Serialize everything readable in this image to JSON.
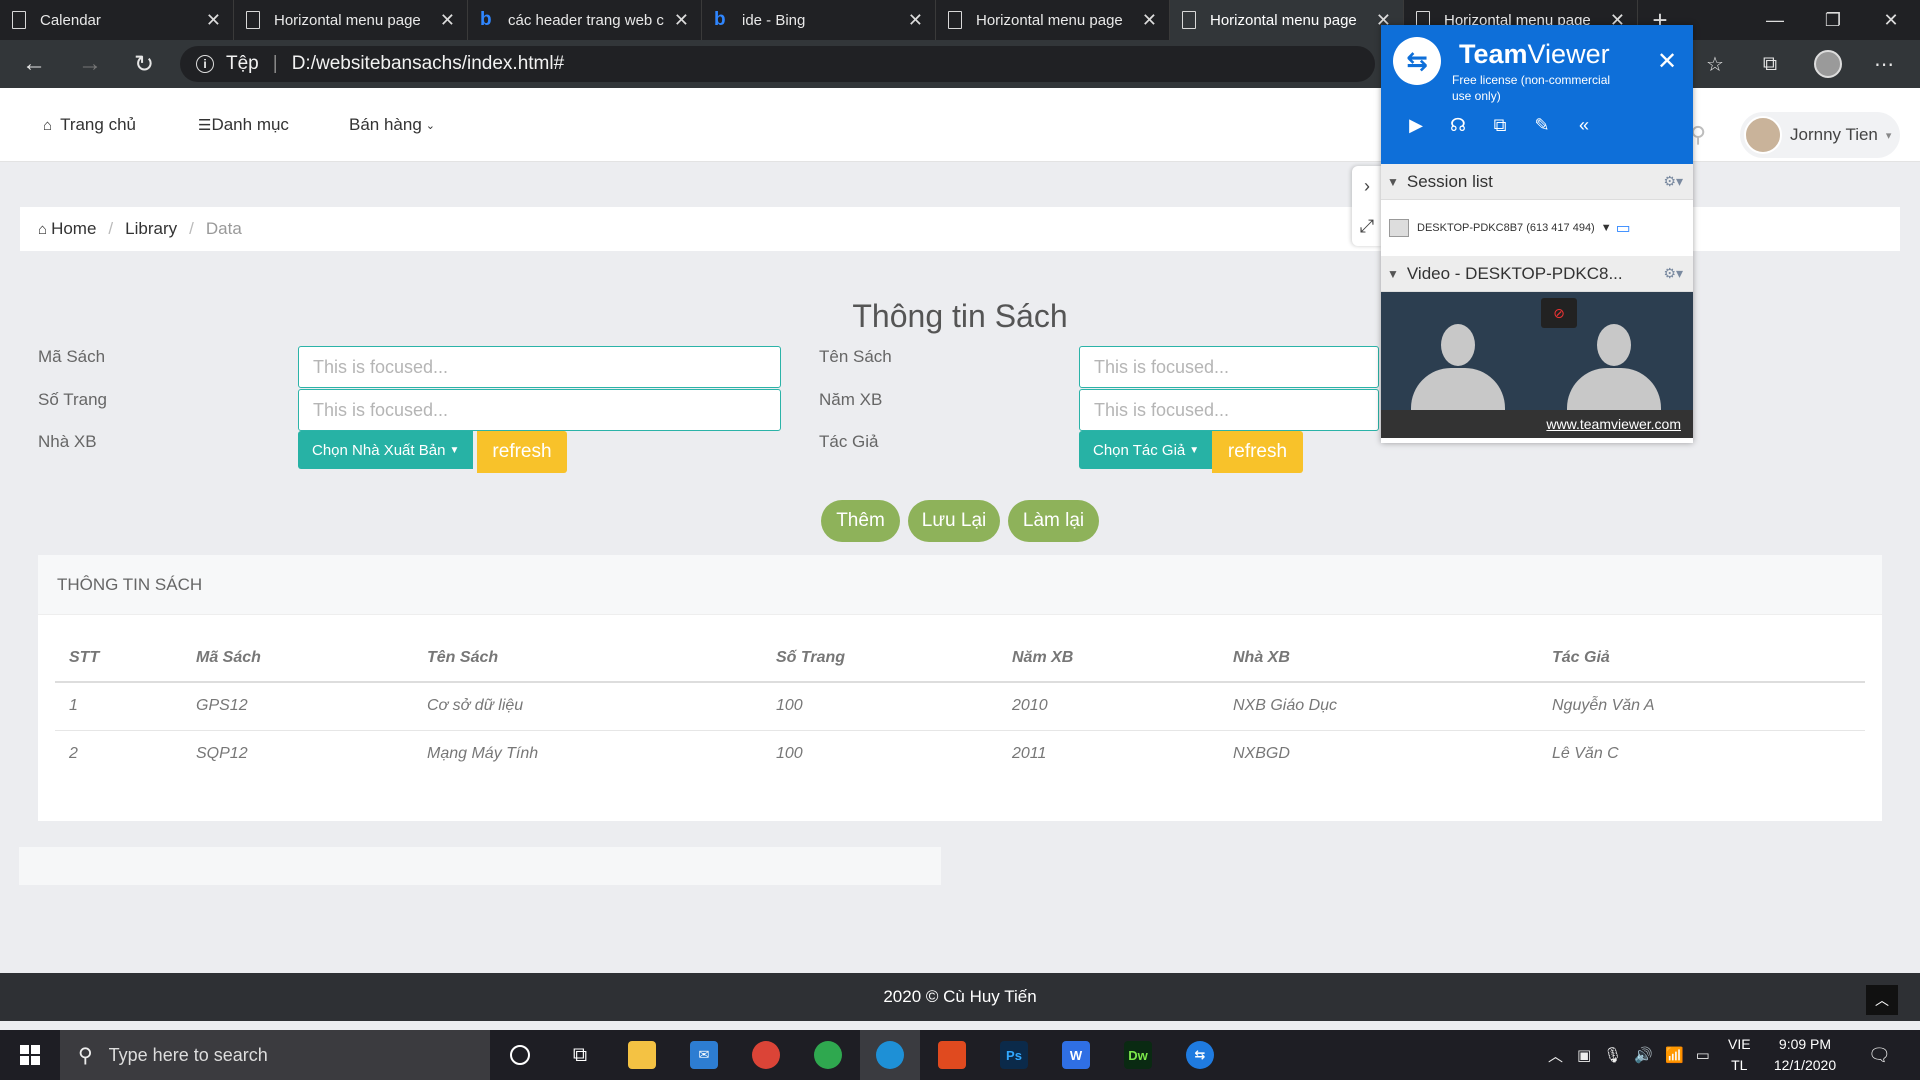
{
  "browser": {
    "tabs": [
      {
        "title": "Calendar",
        "icon": "page-icon",
        "active": false
      },
      {
        "title": "Horizontal menu page",
        "icon": "page-icon",
        "active": false
      },
      {
        "title": "các header trang web c",
        "icon": "bing-icon",
        "active": false
      },
      {
        "title": "ide - Bing",
        "icon": "bing-icon",
        "active": false
      },
      {
        "title": "Horizontal menu page",
        "icon": "page-icon",
        "active": false
      },
      {
        "title": "Horizontal menu page",
        "icon": "page-icon",
        "active": true
      },
      {
        "title": "Horizontal menu page",
        "icon": "page-icon",
        "active": false
      }
    ],
    "address": {
      "scheme_label": "Tệp",
      "url": "D:/websitebansachs/index.html#"
    }
  },
  "nav": {
    "home": "Trang chủ",
    "category": "Danh mục",
    "sales": "Bán hàng",
    "user_name": "Jornny Tien"
  },
  "breadcrumb": {
    "home": "Home",
    "library": "Library",
    "current": "Data"
  },
  "form": {
    "title": "Thông tin Sách",
    "labels": {
      "ma_sach": "Mã Sách",
      "so_trang": "Số Trang",
      "nha_xb": "Nhà XB",
      "ten_sach": "Tên Sách",
      "nam_xb": "Năm XB",
      "tac_gia": "Tác Giả"
    },
    "placeholder": "This is focused...",
    "publisher_dropdown": "Chọn Nhà Xuất Bản",
    "author_dropdown": "Chọn Tác Giả",
    "refresh": "refresh",
    "buttons": {
      "add": "Thêm",
      "save": "Lưu Lại",
      "reset": "Làm lại"
    }
  },
  "table": {
    "heading": "THÔNG TIN SÁCH",
    "columns": [
      "STT",
      "Mã Sách",
      "Tên Sách",
      "Số Trang",
      "Năm XB",
      "Nhà XB",
      "Tác Giả"
    ],
    "rows": [
      [
        "1",
        "GPS12",
        "Cơ sở dữ liệu",
        "100",
        "2010",
        "NXB Giáo Dục",
        "Nguyễn Văn A"
      ],
      [
        "2",
        "SQP12",
        "Mạng Máy Tính",
        "100",
        "2011",
        "NXBGD",
        "Lê Văn C"
      ]
    ]
  },
  "footer": {
    "text": "2020 © Cù Huy Tiến"
  },
  "teamviewer": {
    "brand_bold": "Team",
    "brand_rest": "Viewer",
    "license": "Free license (non-commercial use only)",
    "session_list": "Session list",
    "session_entry": "DESKTOP-PDKC8B7 (613 417 494)",
    "video_title": "Video - DESKTOP-PDKC8...",
    "link": "www.teamviewer.com"
  },
  "taskbar": {
    "search_placeholder": "Type here to search",
    "lang_top": "VIE",
    "lang_bottom": "TL",
    "time": "9:09 PM",
    "date": "12/1/2020"
  },
  "colors": {
    "teal": "#27b2a5",
    "yellow": "#f8c22a",
    "green": "#8eb25a",
    "teamviewer_blue": "#0e6fd9"
  }
}
